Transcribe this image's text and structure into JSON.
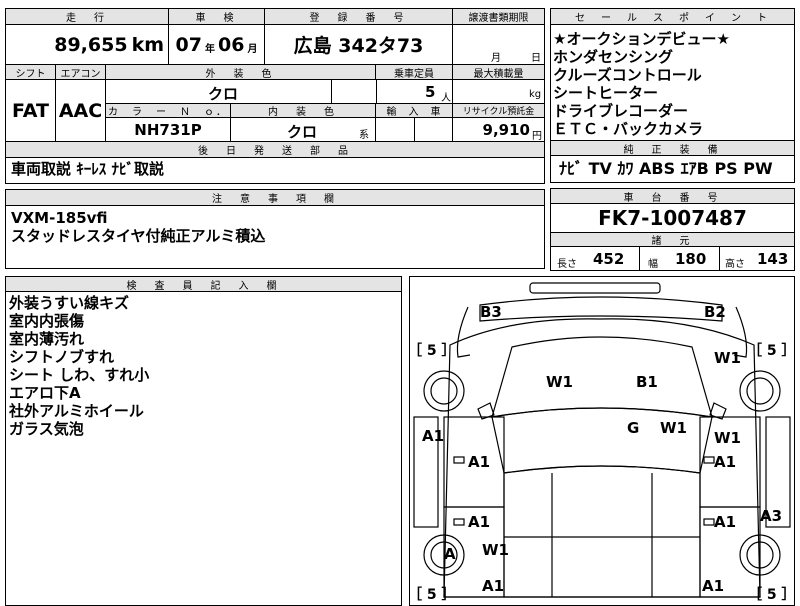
{
  "header": {
    "mileage_label": "走　行",
    "mileage_value": "89,655",
    "mileage_unit": "km",
    "inspection_label": "車　検",
    "inspection_year": "07",
    "inspection_year_unit": "年",
    "inspection_month": "06",
    "inspection_month_unit": "月",
    "registration_label": "登　録　番　号",
    "registration_value": "広島 342タ73",
    "transfer_label": "譲渡書類期限",
    "transfer_month_unit": "月",
    "transfer_day_unit": "日"
  },
  "row2": {
    "shift_label": "シフト",
    "shift_value": "FAT",
    "ac_label": "エアコン",
    "ac_value": "AAC",
    "exterior_label": "外　装　色",
    "exterior_value": "クロ",
    "capacity_label": "乗車定員",
    "capacity_value": "5",
    "capacity_unit": "人",
    "load_label": "最大積載量",
    "load_unit": "kg",
    "color_no_label": "カ　ラ　ー　Ｎ　ｏ．",
    "color_no_value": "NH731P",
    "interior_label": "内　装　色",
    "interior_value": "クロ",
    "interior_unit": "系",
    "import_label": "輸　入　車",
    "recycle_label": "リサイクル預託金",
    "recycle_value": "9,910",
    "recycle_unit": "円"
  },
  "parts": {
    "label": "後　日　発　送　部　品",
    "value": "車両取説 ｷｰﾚｽ ﾅﾋﾞ取説"
  },
  "notes": {
    "label": "注　意　事　項　欄",
    "lines": [
      "VXM-185vfi",
      "スタッドレスタイヤ付純正アルミ積込"
    ]
  },
  "inspector": {
    "label": "検　査　員　記　入　欄",
    "lines": [
      "外装うすい線キズ",
      "室内内張傷",
      "室内薄汚れ",
      "シフトノブすれ",
      "シート しわ、すれ小",
      "エアロ下A",
      "社外アルミホイール",
      "ガラス気泡"
    ]
  },
  "sales": {
    "label": "セ　ー　ル　ス　ポ　イ　ン　ト",
    "lines": [
      "★オークションデビュー★",
      "ホンダセンシング",
      "クルーズコントロール",
      "シートヒーター",
      "ドライブレコーダー",
      "ＥＴＣ・バックカメラ"
    ]
  },
  "equipment": {
    "label": "純　正　装　備",
    "value": "ﾅﾋﾞ TV ｶﾜ ABS ｴｱB PS PW"
  },
  "chassis": {
    "label": "車　台　番　号",
    "value": "FK7-1007487",
    "specs_label": "諸　元",
    "length_label": "長さ",
    "length_value": "452",
    "width_label": "幅",
    "width_value": "180",
    "height_label": "高さ",
    "height_value": "143"
  },
  "diagram": {
    "tire_left_top": "［ 5 ］",
    "tire_right_top": "［ 5 ］",
    "tire_left_bottom": "［ 5 ］",
    "tire_right_bottom": "［ 5 ］",
    "marks": {
      "b3": "B3",
      "b2": "B2",
      "w1_hood_l": "W1",
      "b1_hood": "B1",
      "w1_fender_r": "W1",
      "g_glass": "G",
      "w1_glass": "W1",
      "a1_left": "A1",
      "a1_door_fl": "A1",
      "a1_door_fr": "A1",
      "w1_door_r": "W1",
      "a1_door_rl": "A1",
      "a1_door_rr": "A1",
      "a3_right": "A3",
      "a_wheel": "A",
      "w1_rear_l": "W1",
      "a1_rear_l": "A1",
      "a1_rear_r": "A1"
    }
  }
}
